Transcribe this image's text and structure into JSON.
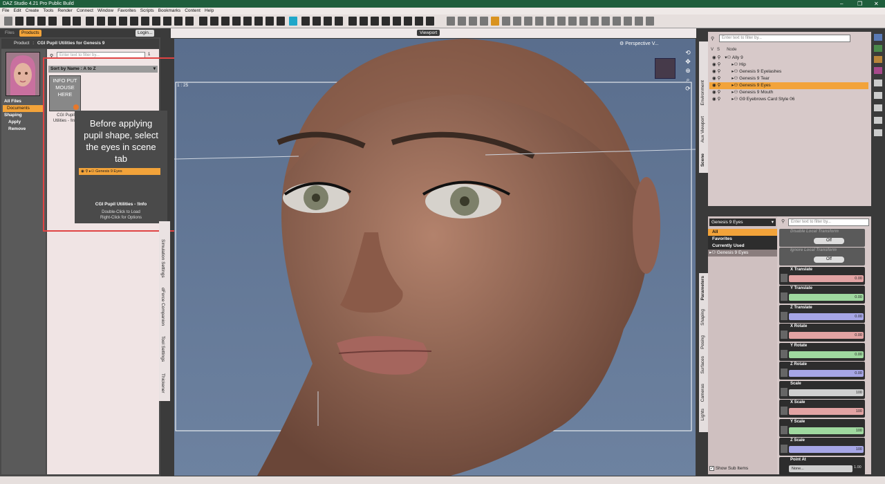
{
  "window": {
    "title": "DAZ Studio 4.21 Pro Public Build",
    "min": "–",
    "max": "❐",
    "close": "✕"
  },
  "menu": [
    "File",
    "Edit",
    "Create",
    "Tools",
    "Render",
    "Connect",
    "Window",
    "Favorites",
    "Scripts",
    "Bookmarks",
    "Content",
    "Help"
  ],
  "left": {
    "tab_files": "Files",
    "tab_products": "Products",
    "login": "Login...",
    "breadcrumb_product": "Product",
    "breadcrumb_title": "CGI Pupil Utilities for Genesis 9",
    "search_placeholder": "Enter text to filter by...",
    "page": "1",
    "sort": "Sort by Name : A to Z",
    "all_files": "All Files",
    "documents": "Documents",
    "shaping": "Shaping",
    "apply": "Apply",
    "remove": "Remove",
    "thumb_text": "INFO PUT MOUSE HERE",
    "item_name_1": "CGI Pupil",
    "item_name_2": "Utilities - !Info",
    "popup_note": "Before applying pupil shape, select the eyes in scene tab",
    "popup_node": "Genesis 9 Eyes",
    "popup_title": "CGI Pupil Utilities - !Info",
    "popup_line1": "Double-Click to Load",
    "popup_line2": "Right-Click for Options"
  },
  "left_vtabs": [
    "Simulation Settings",
    "dForce Companion",
    "Tool Settings",
    "Thickener"
  ],
  "viewport": {
    "tab": "Viewport",
    "camera": "Perspective V...",
    "frame_label": "1 : 25"
  },
  "scene": {
    "search_placeholder": "Enter text to filter by...",
    "col_v": "V",
    "col_s": "S",
    "col_node": "Node",
    "nodes": [
      "Ally 9",
      "Hip",
      "Genesis 9 Eyelashes",
      "Genesis 9 Tear",
      "Genesis 9 Eyes",
      "Genesis 9 Mouth",
      "G9 Eyebrows Card Style 06"
    ],
    "selected": "Genesis 9 Eyes"
  },
  "right_vtabs_top": [
    "Environment",
    "Aux Viewport",
    "Scene"
  ],
  "right_vtabs_bottom": [
    "Parameters",
    "Shaping",
    "Posing",
    "Surfaces",
    "Cameras",
    "Lights"
  ],
  "params": {
    "node_select": "Genesis 9 Eyes",
    "search_placeholder": "Enter text to filter by...",
    "groups": [
      "All",
      "Favorites",
      "Currently Used"
    ],
    "tree_item": "Genesis 9 Eyes",
    "disable_local": "Disable Local Transform",
    "ignore_local": "Ignore Local Transform",
    "off": "Off",
    "sliders": [
      {
        "label": "X Translate",
        "value": "0.00",
        "color": "#e2a3a3"
      },
      {
        "label": "Y Translate",
        "value": "0.00",
        "color": "#9fd89f"
      },
      {
        "label": "Z Translate",
        "value": "0.00",
        "color": "#a6a6e6"
      },
      {
        "label": "X Rotate",
        "value": "0.00",
        "color": "#e2a3a3"
      },
      {
        "label": "Y Rotate",
        "value": "0.00",
        "color": "#9fd89f"
      },
      {
        "label": "Z Rotate",
        "value": "0.00",
        "color": "#a6a6e6"
      },
      {
        "label": "Scale",
        "value": "100",
        "color": "#cfcfcf"
      },
      {
        "label": "X Scale",
        "value": "100",
        "color": "#e2a3a3"
      },
      {
        "label": "Y Scale",
        "value": "100",
        "color": "#9fd89f"
      },
      {
        "label": "Z Scale",
        "value": "100",
        "color": "#a6a6e6"
      }
    ],
    "point_at": "Point At",
    "point_at_value": "None...",
    "point_at_num": "1.00",
    "show_sub": "Show Sub Items"
  },
  "colors": {
    "accent": "#f2a33a",
    "title_green": "#1f5e3c",
    "highlight_box": "#e04343"
  }
}
